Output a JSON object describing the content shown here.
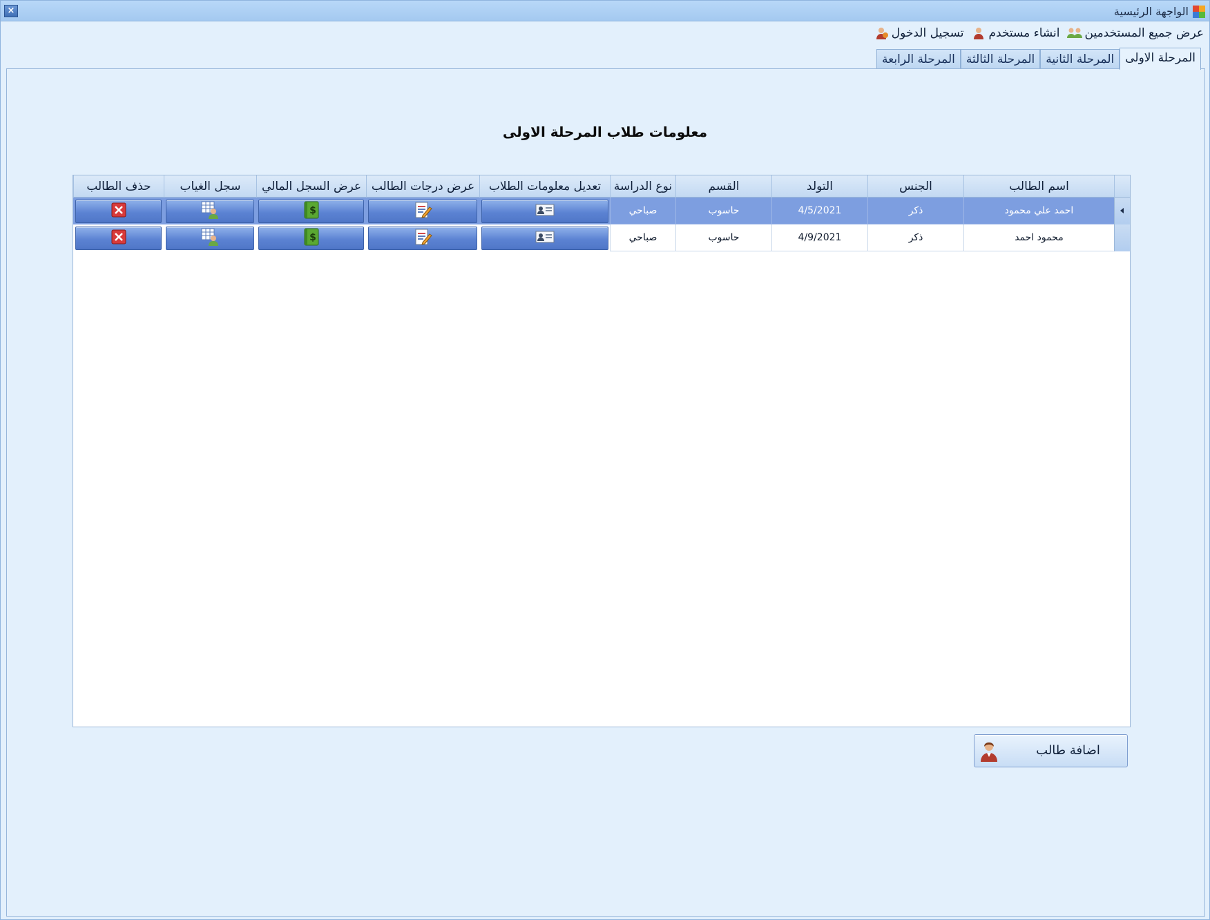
{
  "window": {
    "title": "الواجهة الرئيسية",
    "close_glyph": "×"
  },
  "menu": [
    {
      "label": "تسجيل الدخول",
      "icon": "user-login-icon"
    },
    {
      "label": "انشاء مستخدم",
      "icon": "user-add-icon"
    },
    {
      "label": "عرض جميع المستخدمين",
      "icon": "users-group-icon"
    }
  ],
  "tabs": [
    {
      "label": "المرحلة الاولى",
      "active": true
    },
    {
      "label": "المرحلة الثانية",
      "active": false
    },
    {
      "label": "المرحلة الثالثة",
      "active": false
    },
    {
      "label": "المرحلة الرابعة",
      "active": false
    }
  ],
  "page": {
    "title": "معلومات طلاب المرحلة الاولى"
  },
  "grid": {
    "columns": [
      "اسم الطالب",
      "الجنس",
      "التولد",
      "القسم",
      "نوع الدراسة",
      "تعديل معلومات الطلاب",
      "عرض درجات الطالب",
      "عرض السجل المالي",
      "سجل الغياب",
      "حذف الطالب"
    ],
    "rows": [
      {
        "name": "احمد علي محمود",
        "gender": "ذكر",
        "birth": "4/5/2021",
        "dept": "حاسوب",
        "study": "صباحي",
        "selected": true
      },
      {
        "name": "محمود احمد",
        "gender": "ذكر",
        "birth": "4/9/2021",
        "dept": "حاسوب",
        "study": "صباحي",
        "selected": false
      }
    ],
    "action_icons": [
      "id-card-icon",
      "edit-document-icon",
      "money-book-icon",
      "attendance-grid-icon",
      "delete-icon"
    ]
  },
  "actions": {
    "add_student": "اضافة طالب"
  },
  "colors": {
    "selected_row": "#7d9ee0",
    "button": "#5c83d3",
    "delete": "#d83a3a",
    "money": "#4a9a2c"
  }
}
